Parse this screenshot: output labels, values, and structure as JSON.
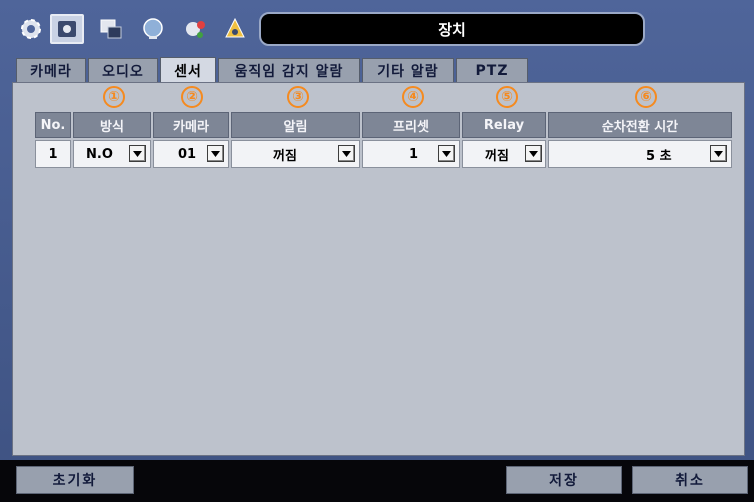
{
  "window": {
    "title": "장치"
  },
  "toolbar": {
    "icons": [
      "settings-gear-icon",
      "camera-device-icon",
      "display-icon",
      "network-globe-icon",
      "record-icon",
      "event-icon"
    ]
  },
  "tabs": [
    {
      "label": "카메라"
    },
    {
      "label": "오디오"
    },
    {
      "label": "센서",
      "active": true
    },
    {
      "label": "움직임 감지 알람"
    },
    {
      "label": "기타 알람"
    },
    {
      "label": "PTZ"
    }
  ],
  "markers": [
    "①",
    "②",
    "③",
    "④",
    "⑤",
    "⑥"
  ],
  "table": {
    "headers": [
      "No.",
      "방식",
      "카메라",
      "알림",
      "프리셋",
      "Relay",
      "순차전환 시간"
    ],
    "rows": [
      {
        "no": "1",
        "mode": "N.O",
        "camera": "01",
        "alarm": "꺼짐",
        "preset": "1",
        "relay": "꺼짐",
        "sequence_time": "5 초"
      }
    ]
  },
  "buttons": {
    "reset": "초기화",
    "save": "저장",
    "cancel": "취소"
  },
  "colors": {
    "marker": "#f58a1f",
    "header_bg": "#7e8696",
    "panel_bg": "#bdc2cc",
    "title_bg": "#000000"
  }
}
